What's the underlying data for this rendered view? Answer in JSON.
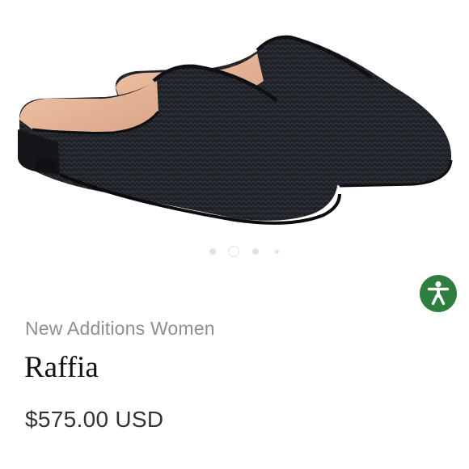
{
  "product": {
    "breadcrumb": "New Additions Women",
    "title": "Raffia",
    "price": "$575.00 USD",
    "image_icon": "slipper-mule-image",
    "shoe_color": "#1b1d22",
    "lining_color": "#e8b79a"
  },
  "carousel": {
    "slide_count": 4,
    "active_index": 1
  },
  "accessibility": {
    "icon": "accessibility-person-icon",
    "color": "#2f7d3f"
  }
}
